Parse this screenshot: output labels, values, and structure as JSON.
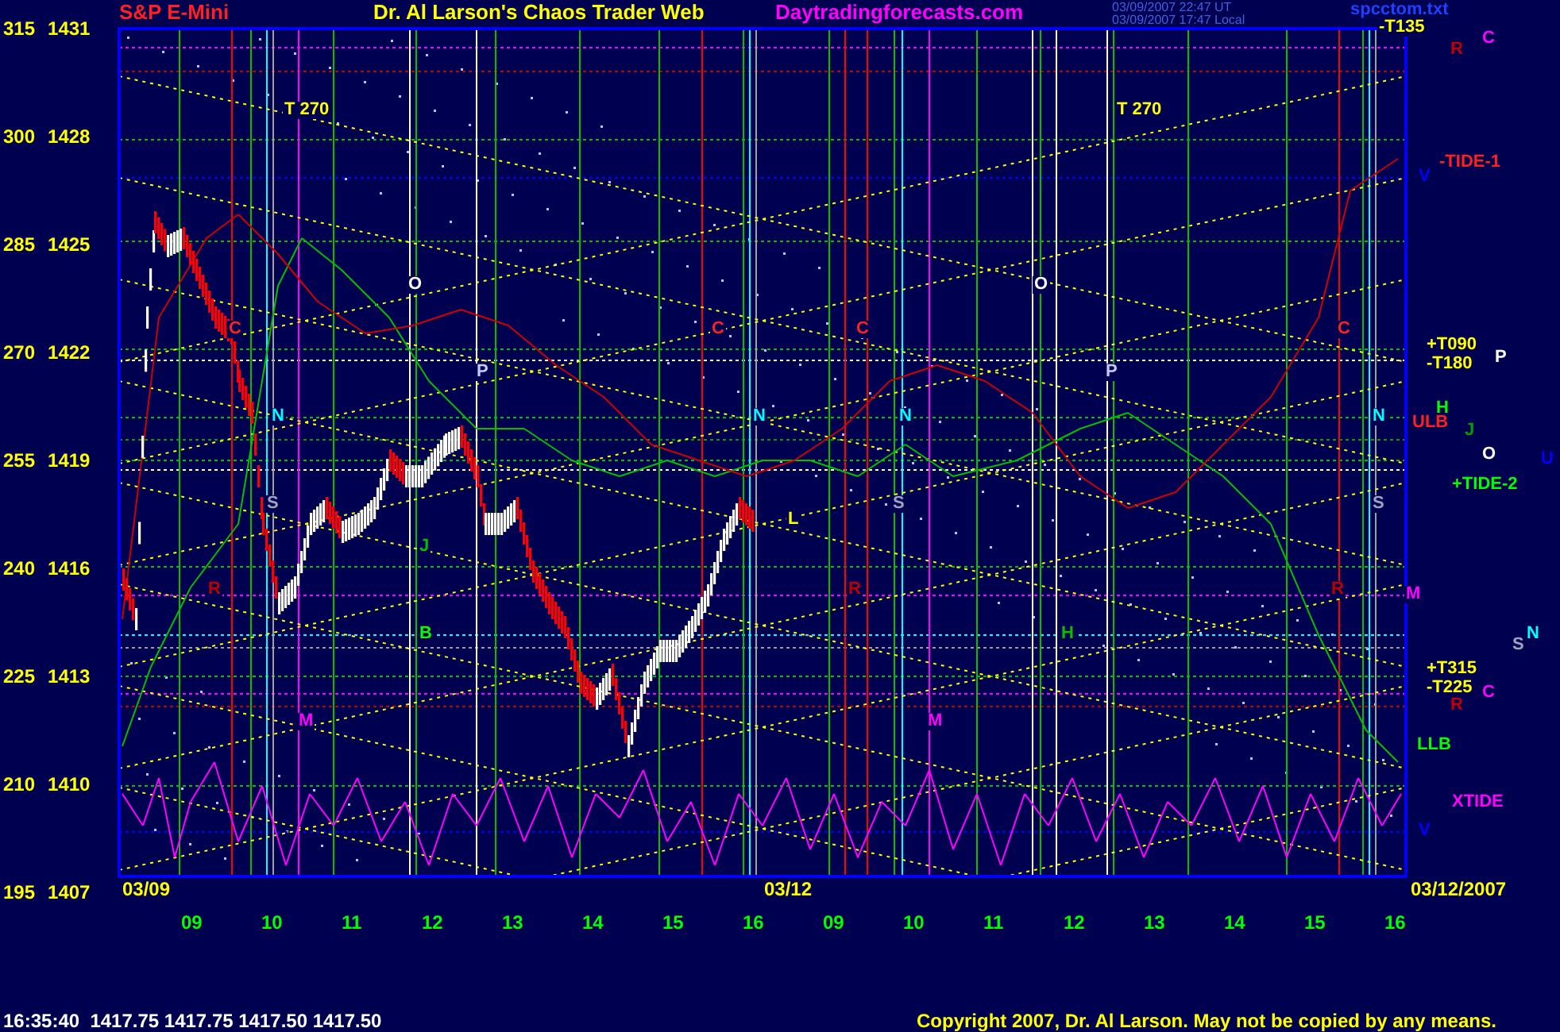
{
  "header": {
    "symbol": "S&P E-Mini",
    "title": "Dr. Al Larson's Chaos Trader Web",
    "site": "Daytradingforecasts.com",
    "timestamps": [
      "03/09/2007 22:47 UT",
      "03/09/2007 17:47 Local"
    ],
    "file": "spcctom.txt"
  },
  "y_axis_labels": [
    {
      "angle": "315",
      "price": "1431"
    },
    {
      "angle": "300",
      "price": "1428"
    },
    {
      "angle": "285",
      "price": "1425"
    },
    {
      "angle": "270",
      "price": "1422"
    },
    {
      "angle": "255",
      "price": "1419"
    },
    {
      "angle": "240",
      "price": "1416"
    },
    {
      "angle": "225",
      "price": "1413"
    },
    {
      "angle": "210",
      "price": "1410"
    },
    {
      "angle": "195",
      "price": "1407"
    }
  ],
  "x_axis_labels": [
    "09",
    "10",
    "11",
    "12",
    "13",
    "14",
    "15",
    "16",
    "09",
    "10",
    "11",
    "12",
    "13",
    "14",
    "15",
    "16"
  ],
  "date_labels": [
    "03/09",
    "03/12",
    "03/12/2007"
  ],
  "annotations": [
    {
      "text": "T 270",
      "color": "#ffff00"
    },
    {
      "text": "O",
      "color": "#ffffff"
    },
    {
      "text": "P",
      "color": "#c8c8ff"
    },
    {
      "text": "C",
      "color": "#ff2020"
    },
    {
      "text": "N",
      "color": "#00ffff"
    },
    {
      "text": "S",
      "color": "#a0a0c0"
    },
    {
      "text": "J",
      "color": "#00c000"
    },
    {
      "text": "R",
      "color": "#c00000"
    },
    {
      "text": "B",
      "color": "#00ff00"
    },
    {
      "text": "M",
      "color": "#ff00ff"
    },
    {
      "text": "C",
      "color": "#ff2020"
    },
    {
      "text": "N",
      "color": "#00ffff"
    },
    {
      "text": "R",
      "color": "#c00000"
    },
    {
      "text": "L",
      "color": "#ffff00"
    },
    {
      "text": "C",
      "color": "#ff2020"
    },
    {
      "text": "N",
      "color": "#00ffff"
    },
    {
      "text": "S",
      "color": "#a0a0c0"
    },
    {
      "text": "M",
      "color": "#ff00ff"
    },
    {
      "text": "T 270",
      "color": "#ffff00"
    },
    {
      "text": "O",
      "color": "#ffffff"
    },
    {
      "text": "P",
      "color": "#c8c8ff"
    },
    {
      "text": "H",
      "color": "#00c000"
    },
    {
      "text": "C",
      "color": "#ff2020"
    },
    {
      "text": "N",
      "color": "#00ffff"
    },
    {
      "text": "S",
      "color": "#a0a0c0"
    },
    {
      "text": "R",
      "color": "#c00000"
    },
    {
      "text": "-T135",
      "color": "#ffff00"
    },
    {
      "text": "C",
      "color": "#ff00ff"
    },
    {
      "text": "R",
      "color": "#c00000"
    },
    {
      "text": "-TIDE-1",
      "color": "#ff2020"
    },
    {
      "text": "V",
      "color": "#0000ff"
    },
    {
      "text": "+T090",
      "color": "#ffff00"
    },
    {
      "text": "-T180",
      "color": "#ffff00"
    },
    {
      "text": "P",
      "color": "#ffffff"
    },
    {
      "text": "H",
      "color": "#00ff00"
    },
    {
      "text": "ULB",
      "color": "#ff2020"
    },
    {
      "text": "J",
      "color": "#00a000"
    },
    {
      "text": "O",
      "color": "#ffffff"
    },
    {
      "text": "U",
      "color": "#0000ff"
    },
    {
      "text": "+TIDE-2",
      "color": "#00ff00"
    },
    {
      "text": "M",
      "color": "#ff00ff"
    },
    {
      "text": "N",
      "color": "#00ffff"
    },
    {
      "text": "S",
      "color": "#a0a0c0"
    },
    {
      "text": "+T315",
      "color": "#ffff00"
    },
    {
      "text": "-T225",
      "color": "#ffff00"
    },
    {
      "text": "C",
      "color": "#ff00ff"
    },
    {
      "text": "R",
      "color": "#c00000"
    },
    {
      "text": "LLB",
      "color": "#00ff00"
    },
    {
      "text": "XTIDE",
      "color": "#ff00ff"
    },
    {
      "text": "V",
      "color": "#0000ff"
    }
  ],
  "status_bar": {
    "quote": "16:35:40  1417.75 1417.75 1417.50 1417.50",
    "copyright": "Copyright 2007, Dr. Al Larson. May not be copied by any means."
  }
}
